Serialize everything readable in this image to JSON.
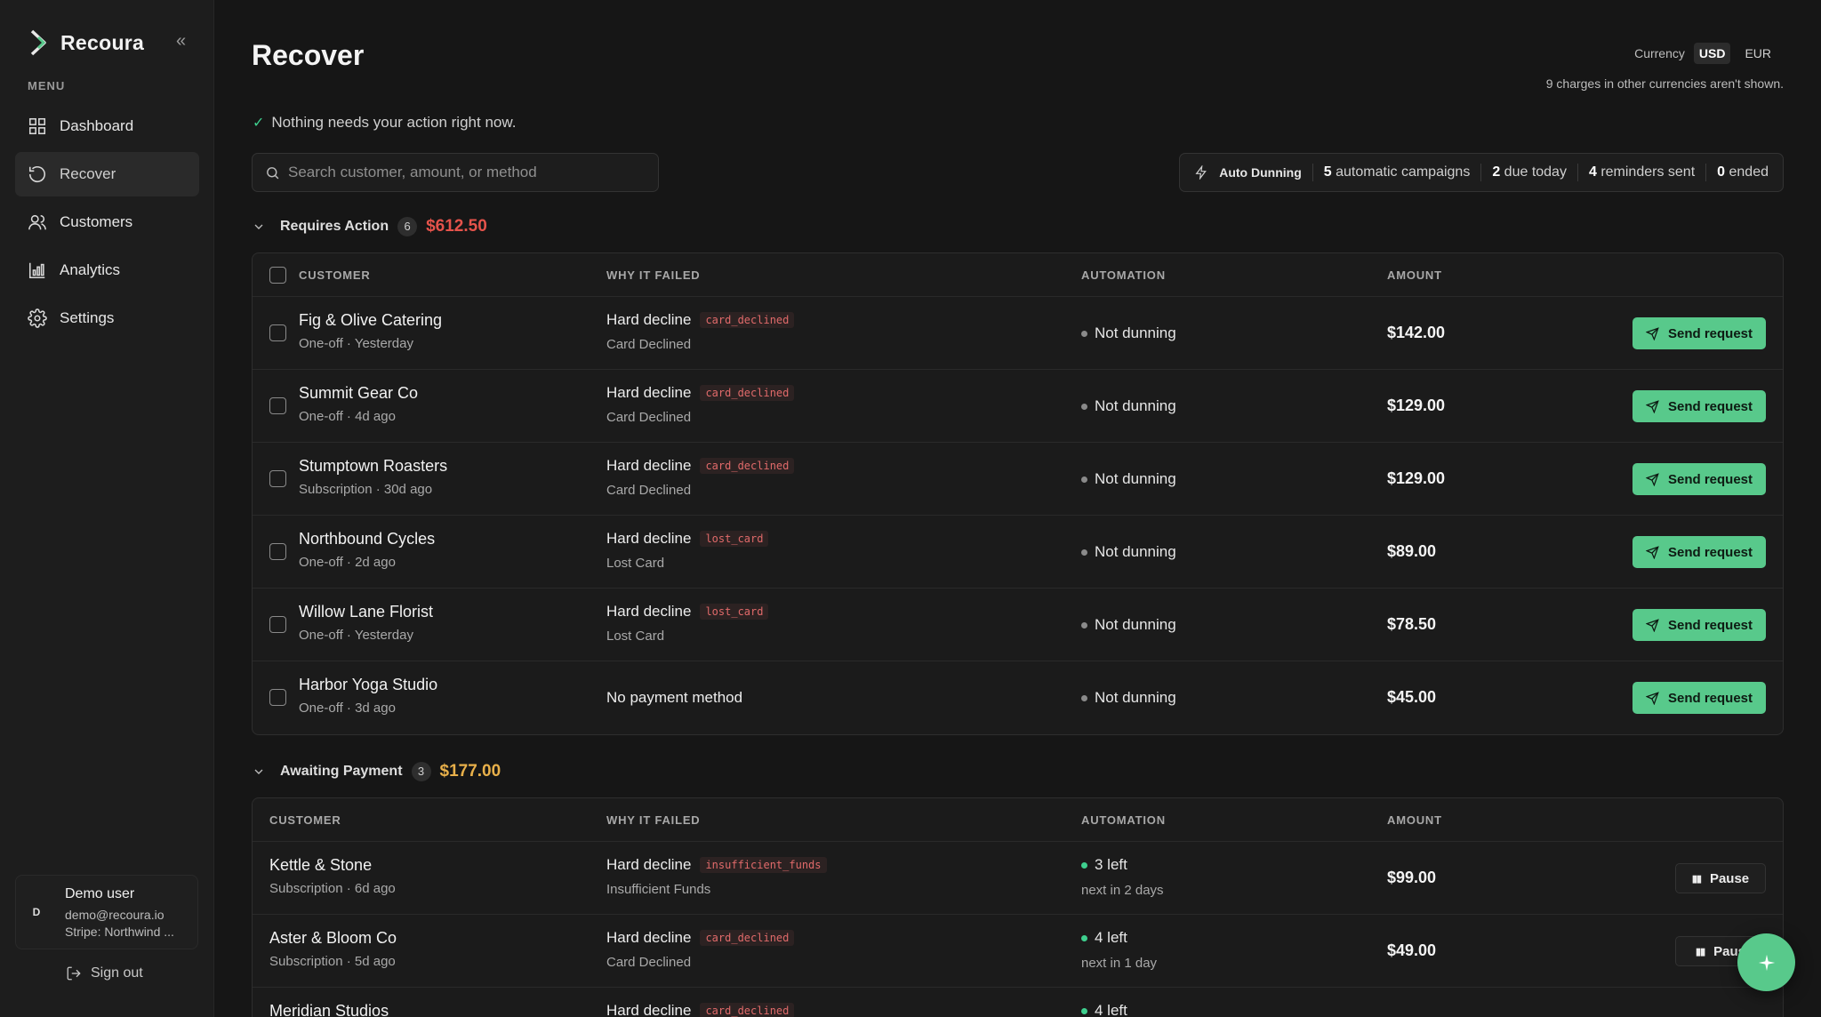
{
  "app": {
    "name": "Recoura",
    "collapse_icon": "chevrons-left-icon"
  },
  "sidebar": {
    "menu_label": "MENU",
    "items": [
      {
        "label": "Dashboard",
        "icon": "grid-icon",
        "active": false
      },
      {
        "label": "Recover",
        "icon": "refresh-icon",
        "active": true
      },
      {
        "label": "Customers",
        "icon": "users-icon",
        "active": false
      },
      {
        "label": "Analytics",
        "icon": "bar-chart-icon",
        "active": false
      },
      {
        "label": "Settings",
        "icon": "gear-icon",
        "active": false
      }
    ],
    "user": {
      "initial": "D",
      "name": "Demo user",
      "email": "demo@recoura.io",
      "stripe": "Stripe: Northwind ..."
    },
    "sign_out": "Sign out"
  },
  "header": {
    "title": "Recover",
    "currency_label": "Currency",
    "currency_options": [
      "USD",
      "EUR"
    ],
    "currency_selected": "USD",
    "currency_note": "9 charges in other currencies aren't shown.",
    "status": "Nothing needs your action right now."
  },
  "search": {
    "placeholder": "Search customer, amount, or method",
    "value": ""
  },
  "dunning": {
    "label": "Auto Dunning",
    "campaigns_count": "5",
    "campaigns_text": "automatic campaigns",
    "due_count": "2",
    "due_text": "due today",
    "reminders_count": "4",
    "reminders_text": "reminders sent",
    "ended_count": "0",
    "ended_text": "ended"
  },
  "requires_action": {
    "title": "Requires Action",
    "count": "6",
    "total": "$612.50",
    "total_color": "#e5534b",
    "columns": [
      "CUSTOMER",
      "WHY IT FAILED",
      "AUTOMATION",
      "AMOUNT"
    ],
    "action_label": "Send request",
    "rows": [
      {
        "customer": "Fig & Olive Catering",
        "sub": "One-off · Yesterday",
        "reason": "Hard decline",
        "code": "card_declined",
        "reason_sub": "Card Declined",
        "automation": "Not dunning",
        "amount": "$142.00"
      },
      {
        "customer": "Summit Gear Co",
        "sub": "One-off · 4d ago",
        "reason": "Hard decline",
        "code": "card_declined",
        "reason_sub": "Card Declined",
        "automation": "Not dunning",
        "amount": "$129.00"
      },
      {
        "customer": "Stumptown Roasters",
        "sub": "Subscription · 30d ago",
        "reason": "Hard decline",
        "code": "card_declined",
        "reason_sub": "Card Declined",
        "automation": "Not dunning",
        "amount": "$129.00"
      },
      {
        "customer": "Northbound Cycles",
        "sub": "One-off · 2d ago",
        "reason": "Hard decline",
        "code": "lost_card",
        "reason_sub": "Lost Card",
        "automation": "Not dunning",
        "amount": "$89.00"
      },
      {
        "customer": "Willow Lane Florist",
        "sub": "One-off · Yesterday",
        "reason": "Hard decline",
        "code": "lost_card",
        "reason_sub": "Lost Card",
        "automation": "Not dunning",
        "amount": "$78.50"
      },
      {
        "customer": "Harbor Yoga Studio",
        "sub": "One-off · 3d ago",
        "reason": "No payment method",
        "code": "",
        "reason_sub": "",
        "automation": "Not dunning",
        "amount": "$45.00"
      }
    ]
  },
  "awaiting_payment": {
    "title": "Awaiting Payment",
    "count": "3",
    "total": "$177.00",
    "total_color": "#e8b04a",
    "columns": [
      "CUSTOMER",
      "WHY IT FAILED",
      "AUTOMATION",
      "AMOUNT"
    ],
    "action_label": "Pause",
    "rows": [
      {
        "customer": "Kettle & Stone",
        "sub": "Subscription · 6d ago",
        "reason": "Hard decline",
        "code": "insufficient_funds",
        "reason_sub": "Insufficient Funds",
        "automation": "3 left",
        "automation_sub": "next in 2 days",
        "amount": "$99.00",
        "action": "Pause"
      },
      {
        "customer": "Aster & Bloom Co",
        "sub": "Subscription · 5d ago",
        "reason": "Hard decline",
        "code": "card_declined",
        "reason_sub": "Card Declined",
        "automation": "4 left",
        "automation_sub": "next in 1 day",
        "amount": "$49.00",
        "action": "Paus"
      },
      {
        "customer": "Meridian Studios",
        "sub": "",
        "reason": "Hard decline",
        "code": "card_declined",
        "reason_sub": "",
        "automation": "4 left",
        "automation_sub": "",
        "amount": "",
        "action": ""
      }
    ]
  },
  "fab": {
    "icon": "sparkle-icon"
  },
  "colors": {
    "accent": "#58c98b",
    "background": "#161616",
    "sidebar": "#1d1d1d",
    "danger": "#e5534b",
    "warning": "#e8b04a"
  }
}
